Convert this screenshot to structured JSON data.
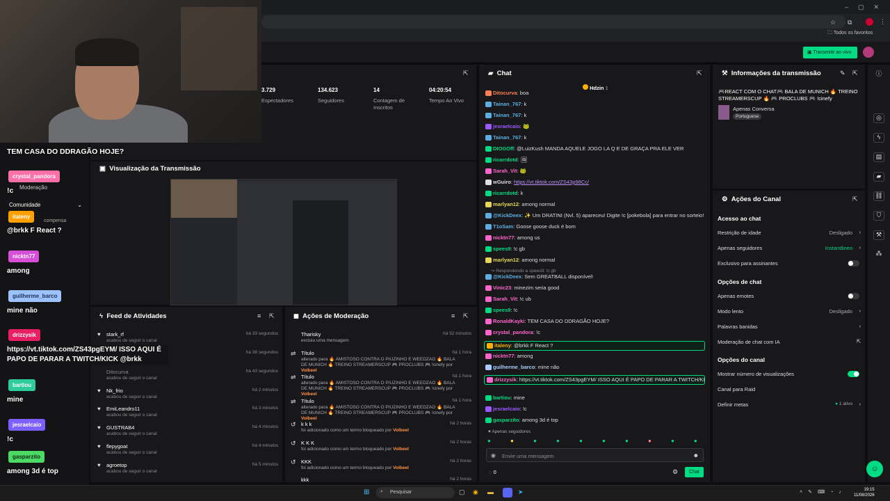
{
  "browser": {
    "bookmarks_label": "Todos os favoritos"
  },
  "appbar": {
    "go_live": "Transmitir ao vivo"
  },
  "stats": [
    {
      "value": "3.729",
      "label": "Espectadores"
    },
    {
      "value": "134.623",
      "label": "Seguidores"
    },
    {
      "value": "14",
      "label": "Contagem de Inscritos"
    },
    {
      "value": "04:20:54",
      "label": "Tempo Ao Vivo"
    }
  ],
  "preview": {
    "title": "Visualização da Transmissão"
  },
  "feed": {
    "title": "Feed de Atividades",
    "rows": [
      {
        "name": "stark_rf",
        "sub": "acabou de seguir o canal",
        "time": "há 33 segundos"
      },
      {
        "name": "",
        "sub": "",
        "time": "há 38 segundos"
      },
      {
        "name": "Ditocurva",
        "sub": "acabou de seguir o canal",
        "time": "há 43 segundos"
      },
      {
        "name": "Nk_frio",
        "sub": "acabou de seguir o canal",
        "time": "há 2 minutos"
      },
      {
        "name": "EmiLeandro11",
        "sub": "acabou de seguir o canal",
        "time": "há 3 minutos"
      },
      {
        "name": "GUSTRAB4",
        "sub": "acabou de seguir o canal",
        "time": "há 4 minutos"
      },
      {
        "name": "flepygoat",
        "sub": "acabou de seguir o canal",
        "time": "há 4 minutos"
      },
      {
        "name": "agroetop",
        "sub": "acabou de seguir o canal",
        "time": "há 5 minutos"
      }
    ]
  },
  "moderation": {
    "title": "Ações de Moderação",
    "by": "Volbeel",
    "rows": [
      {
        "name": "Tharisky",
        "sub": "excluiu uma mensagem",
        "time": "há 52 minutos"
      },
      {
        "name": "Título",
        "sub": "alterado para 🔥 AMISTOSO CONTRA O PIUZINHO E WEEDZAO 🔥 BALA DE MUNICH 🔥 TREINO STREAMERSCUP 🎮 PROCLUBS 🎮 !cinefy por",
        "time": "há 1 hora"
      },
      {
        "name": "Título",
        "sub": "alterado para 🔥 AMISTOSO CONTRA O PIUZINHO E WEEDZAO 🔥 BALA DE MUNICH 🔥 TREINO STREAMERSCUP 🎮 PROCLUBS 🎮 !cinefy por",
        "time": "há 1 hora"
      },
      {
        "name": "Título",
        "sub": "alterado para 🔥 AMISTOSO CONTRA O PIUZINHO E WEEDZAO 🔥 BALA DE MUNICH 🔥 TREINO STREAMERSCUP 🎮 PROCLUBS 🎮 !cinefy por",
        "time": "há 1 hora"
      },
      {
        "name": "k k k",
        "sub": "foi adicionado como um termo bloqueado por",
        "time": "há 2 horas"
      },
      {
        "name": "K K K",
        "sub": "foi adicionado como um termo bloqueado por",
        "time": "há 2 horas"
      },
      {
        "name": "KKK",
        "sub": "foi adicionado como um termo bloqueado por",
        "time": "há 2 horas"
      },
      {
        "name": "kkk",
        "sub": "",
        "time": "há 2 horas"
      }
    ]
  },
  "chat": {
    "title": "Chat",
    "pinned_user": "Hdzin",
    "pinned_count": "1",
    "replying_to": "Respondendo a spees9: !c gb",
    "followers_only": "Apenas seguidores",
    "input_placeholder": "Envie uma mensagem",
    "points": "0",
    "send": "Chat",
    "messages": [
      {
        "user": "Ditocurva",
        "color": "#ff7f50",
        "text": "boa"
      },
      {
        "user": "Tainan_767",
        "color": "#5dade2",
        "text": "k"
      },
      {
        "user": "Tainan_767",
        "color": "#5dade2",
        "text": "k"
      },
      {
        "user": "jesraelcaio",
        "color": "#9b59ff",
        "text": "🐸"
      },
      {
        "user": "Tainan_767",
        "color": "#5dade2",
        "text": "k"
      },
      {
        "user": "DIOGOff",
        "color": "#00db84",
        "text": "@LuizKush MANDA AQUELE JOGO LA Q E DE GRAÇA PRA ELE VER"
      },
      {
        "user": "ricarrdotd",
        "color": "#00db84",
        "text": "🖼"
      },
      {
        "user": "Sarah_Vit",
        "color": "#ff66cc",
        "text": "🐸"
      },
      {
        "user": "wGuiro",
        "color": "#dedee3",
        "text": "https://vt.tiktok.com/ZS43p98Cc/",
        "link": true
      },
      {
        "user": "ricarrdotd",
        "color": "#00db84",
        "text": "k"
      },
      {
        "user": "marlyan12",
        "color": "#e6d855",
        "text": "among normal"
      },
      {
        "user": "@KickDeex",
        "color": "#5dade2",
        "text": "✨ Um DRATINI (Nvl. 5) apareceu! Digite !c [pokebola] para entrar no sorteio!"
      },
      {
        "user": "T1oSam",
        "color": "#5dade2",
        "text": "Goose goose duck é bom"
      },
      {
        "user": "nicktn77",
        "color": "#ff66cc",
        "text": "among us"
      },
      {
        "user": "spees9",
        "color": "#00db84",
        "text": "!c gb"
      },
      {
        "user": "marlyan12",
        "color": "#e6d855",
        "text": "among normal"
      },
      {
        "user": "@KickDeex",
        "color": "#5dade2",
        "text": "Sem GREATBALL disponível!"
      },
      {
        "user": "Vinic23",
        "color": "#ff66cc",
        "text": "minezim seria good"
      },
      {
        "user": "Sarah_Vit",
        "color": "#ff66cc",
        "text": "!c ub"
      },
      {
        "user": "spees9",
        "color": "#00db84",
        "text": "!c"
      },
      {
        "user": "RonaldKayki",
        "color": "#ff66cc",
        "text": "TEM CASA DO DDRAGÃO HOJE?"
      },
      {
        "user": "crystal_pandora",
        "color": "#ff66cc",
        "text": "!c"
      },
      {
        "user": "italeny",
        "color": "#ffb000",
        "text": "@brkk F React ?",
        "highlight": true
      },
      {
        "user": "nicktn77",
        "color": "#ff66cc",
        "text": "among"
      },
      {
        "user": "guilherme_barco",
        "color": "#aaccff",
        "text": "mine não"
      },
      {
        "user": "drizzysik",
        "color": "#ff66cc",
        "text": "https://vt.tiktok.com/ZS43pgEYM/ ISSO AQUI É PAPO DE PARAR A TWITCH/KICK @brkk",
        "highlight": true
      },
      {
        "user": "bartiou",
        "color": "#00db84",
        "text": "mine"
      },
      {
        "user": "jesraelcaio",
        "color": "#9b59ff",
        "text": "!c"
      },
      {
        "user": "gasparzito",
        "color": "#00db84",
        "text": "among 3d é top"
      }
    ]
  },
  "info": {
    "title": "Informações da transmissão",
    "stream_title": "🎮REACT COM O CHAT🎮 BALA DE MUNICH 🔥 TREINO STREAMERSCUP 🔥 🎮 PROCLUBS 🎮 !cinefy",
    "category": "Apenas Conversa",
    "language": "Portuguese"
  },
  "actions": {
    "title": "Ações do Canal",
    "chat_access": "Acesso ao chat",
    "age_restriction": "Restrição de idade",
    "age_value": "Desligado",
    "followers_only": "Apenas seguidores",
    "followers_value": "Instantâneo",
    "subs_only": "Exclusivo para assinantes",
    "chat_options": "Opções de chat",
    "emotes_only": "Apenas emotes",
    "slow_mode": "Modo lento",
    "slow_value": "Desligado",
    "banned_words": "Palavras banidas",
    "ai_mod": "Moderação de chat com IA",
    "channel_options": "Opções do canal",
    "show_viewers": "Mostrar número de visualizações",
    "raid": "Canal para Raid",
    "goals": "Definir metas",
    "goals_value": "1 ativo"
  },
  "overlay": {
    "messages": [
      {
        "user": "",
        "text": "TEM CASA DO DDRAGÃO HOJE?",
        "color": "#e91e63"
      },
      {
        "user": "crystal_pandora",
        "text": "!c",
        "color": "#ff6fa8"
      },
      {
        "user": "italeny",
        "text": "@brkk F React ?",
        "color": "#ff9f00"
      },
      {
        "user": "nicktn77",
        "text": "among",
        "color": "#d74fd7"
      },
      {
        "user": "guilherme_barco",
        "text": "mine não",
        "color": "#9cc3ff"
      },
      {
        "user": "drizzysik",
        "text": "https://vt.tiktok.com/ZS43pgEYM/ ISSO AQUI É PAPO DE PARAR A TWITCH/KICK @brkk",
        "color": "#e91e63"
      },
      {
        "user": "bartiou",
        "text": "mine",
        "color": "#2ecc9a"
      },
      {
        "user": "jesraelcaio",
        "text": "!c",
        "color": "#7d5fff"
      },
      {
        "user": "gasparzito",
        "text": "among 3d é top",
        "color": "#4cd964"
      }
    ],
    "nav_mod": "Moderação",
    "nav_comm": "Comunidade",
    "nav_compensa": "compensa"
  },
  "taskbar": {
    "search": "Pesquisar",
    "time": "19:15",
    "date": "11/08/2026"
  }
}
